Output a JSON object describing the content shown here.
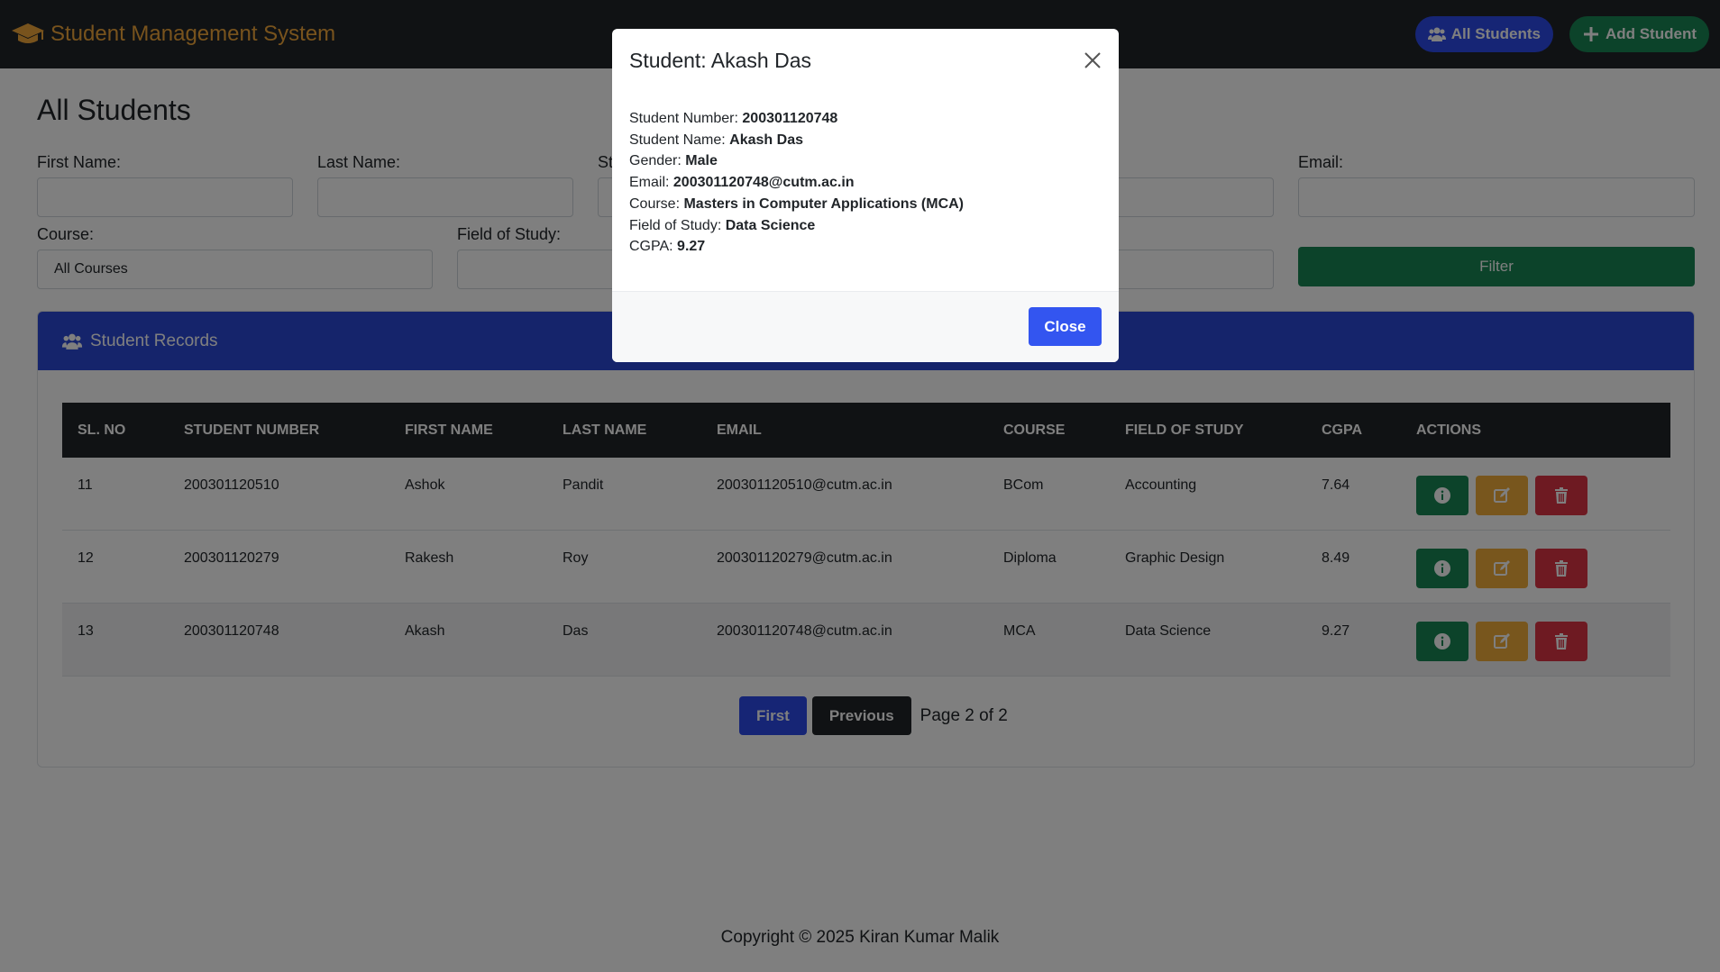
{
  "navbar": {
    "brand": "Student Management System",
    "all_students_label": "All Students",
    "add_student_label": "Add Student"
  },
  "page": {
    "title": "All Students"
  },
  "filters": {
    "first_name_label": "First Name:",
    "last_name_label": "Last Name:",
    "student_number_label_partial": "St",
    "email_label": "Email:",
    "course_label": "Course:",
    "course_value": "All Courses",
    "field_of_study_label": "Field of Study:",
    "filter_button": "Filter"
  },
  "records": {
    "title": "Student Records",
    "columns": [
      "SL. NO",
      "STUDENT NUMBER",
      "FIRST NAME",
      "LAST NAME",
      "EMAIL",
      "COURSE",
      "FIELD OF STUDY",
      "CGPA",
      "ACTIONS"
    ],
    "rows": [
      [
        "11",
        "200301120510",
        "Ashok",
        "Pandit",
        "200301120510@cutm.ac.in",
        "BCom",
        "Accounting",
        "7.64"
      ],
      [
        "12",
        "200301120279",
        "Rakesh",
        "Roy",
        "200301120279@cutm.ac.in",
        "Diploma",
        "Graphic Design",
        "8.49"
      ],
      [
        "13",
        "200301120748",
        "Akash",
        "Das",
        "200301120748@cutm.ac.in",
        "MCA",
        "Data Science",
        "9.27"
      ]
    ]
  },
  "pagination": {
    "first_label": "First",
    "previous_label": "Previous",
    "page_text": "Page 2 of 2"
  },
  "footer": {
    "text": "Copyright © 2025 Kiran Kumar Malik"
  },
  "modal": {
    "title": "Student: Akash Das",
    "details": [
      {
        "label": "Student Number: ",
        "value": "200301120748"
      },
      {
        "label": "Student Name: ",
        "value": "Akash Das"
      },
      {
        "label": "Gender: ",
        "value": "Male"
      },
      {
        "label": "Email: ",
        "value": "200301120748@cutm.ac.in"
      },
      {
        "label": "Course: ",
        "value": "Masters in Computer Applications (MCA)"
      },
      {
        "label": "Field of Study: ",
        "value": "Data Science"
      },
      {
        "label": "CGPA: ",
        "value": "9.27"
      }
    ],
    "close_label": "Close"
  },
  "colors": {
    "navbar_bg": "#212529",
    "brand": "#f0a63b",
    "primary": "#2c4aea",
    "success": "#198754",
    "warning": "#f0ad3a",
    "danger": "#dc3545"
  }
}
